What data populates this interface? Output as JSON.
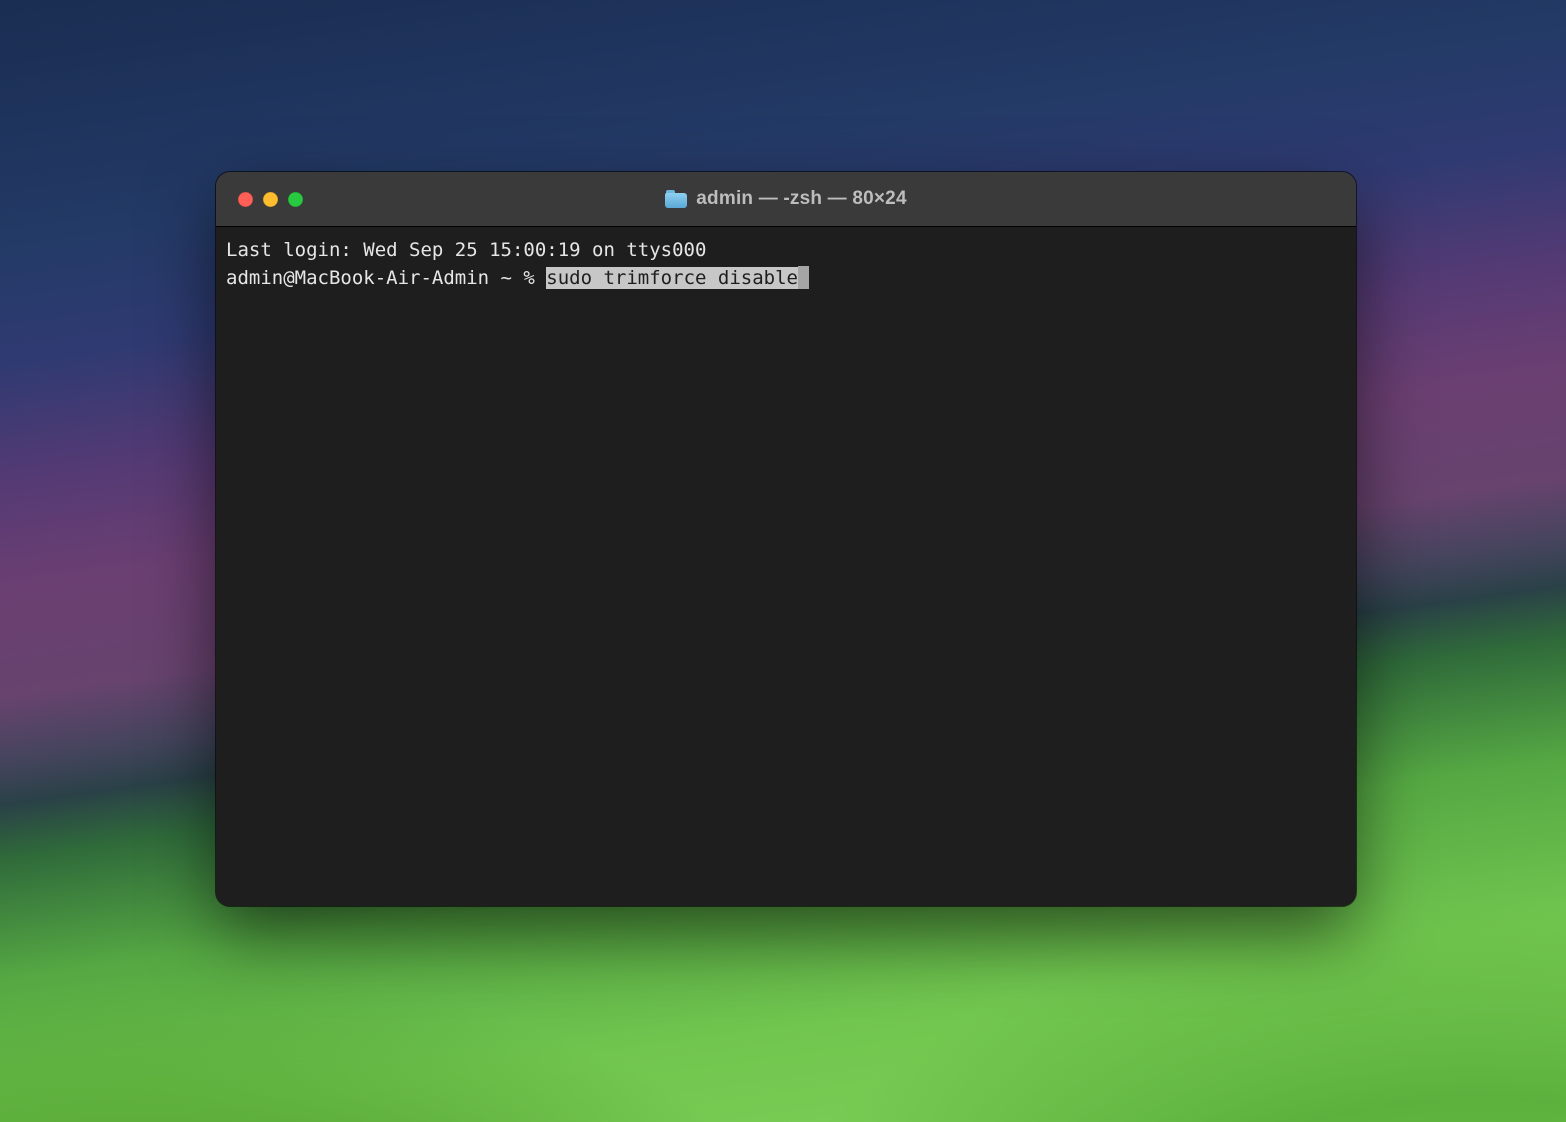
{
  "window": {
    "title": "admin — -zsh — 80×24"
  },
  "terminal": {
    "last_login_line": "Last login: Wed Sep 25 15:00:19 on ttys000",
    "prompt": "admin@MacBook-Air-Admin ~ % ",
    "command_selected": "sudo trimforce disable"
  },
  "traffic_lights": {
    "close": "#ff5f57",
    "minimize": "#febc2e",
    "zoom": "#28c840"
  }
}
